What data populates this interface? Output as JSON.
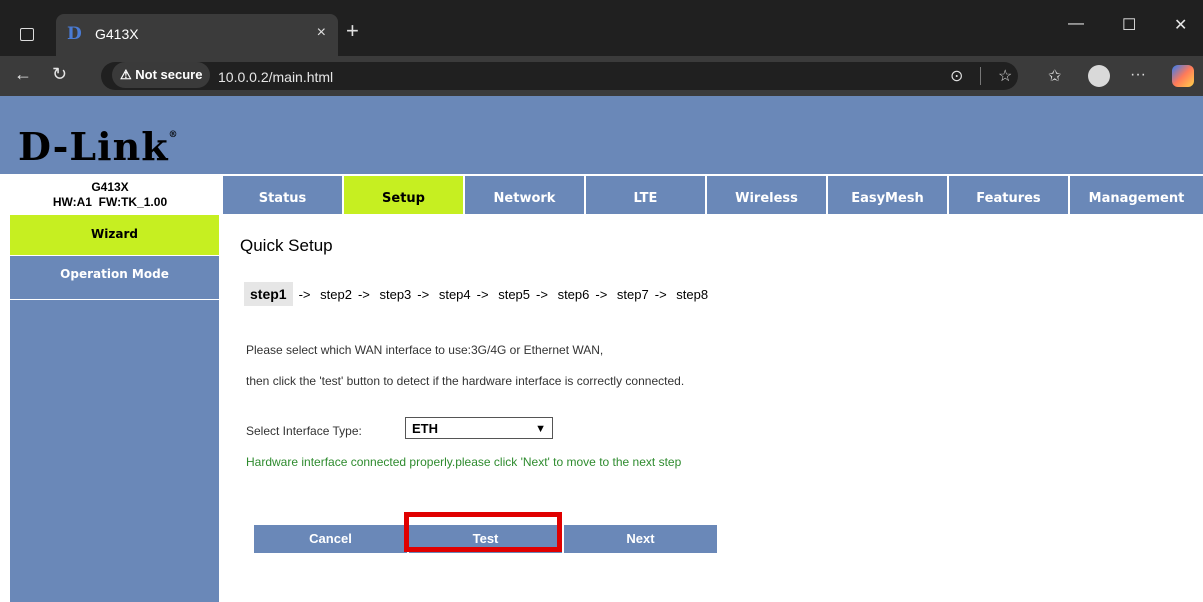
{
  "browser": {
    "tab_title": "G413X",
    "favicon": "D",
    "close_tab": "×",
    "new_tab": "+",
    "not_secure": "Not secure",
    "url": "10.0.0.2/main.html",
    "window": {
      "minimize": "—",
      "maximize": "☐",
      "close": "✕"
    }
  },
  "brand": {
    "logo": "D-Link",
    "registered": "®"
  },
  "device": {
    "model": "G413X",
    "hw": "HW:A1",
    "fw": "FW:TK_1.00"
  },
  "topnav": [
    "Status",
    "Setup",
    "Network",
    "LTE",
    "Wireless",
    "EasyMesh",
    "Features",
    "Management"
  ],
  "active_nav": "Setup",
  "sidebar": [
    "Wizard",
    "Operation Mode"
  ],
  "main": {
    "title": "Quick Setup",
    "steps": [
      "step1",
      "step2",
      "step3",
      "step4",
      "step5",
      "step6",
      "step7",
      "step8"
    ],
    "arrow": "->",
    "desc1": "Please select which WAN interface to use:3G/4G or Ethernet WAN,",
    "desc2": "then click the 'test' button to detect if the hardware interface is correctly connected.",
    "select_label": "Select Interface Type:",
    "select_value": "ETH",
    "ok_msg": "Hardware interface connected properly.please click 'Next' to move to the next step",
    "buttons": {
      "cancel": "Cancel",
      "test": "Test",
      "next": "Next"
    }
  },
  "colors": {
    "nav": "#6a88b8",
    "active": "#c6ef21",
    "highlight": "#e00000",
    "success": "#2e8b2e"
  }
}
